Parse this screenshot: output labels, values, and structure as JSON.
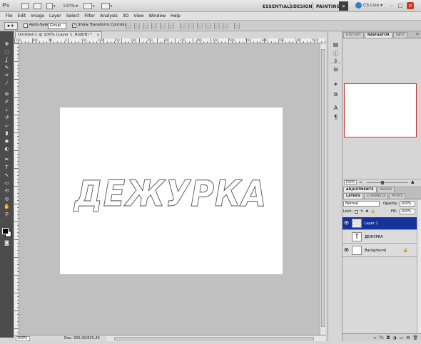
{
  "title_bar": {
    "logo": "Ps",
    "zoom": "100%",
    "workspaces": [
      "ESSENTIALS",
      "DESIGN",
      "PAINTING"
    ],
    "more": "»",
    "cs_live": "CS Live",
    "min": "–",
    "max": "□",
    "close": "×"
  },
  "menu": [
    "File",
    "Edit",
    "Image",
    "Layer",
    "Select",
    "Filter",
    "Analysis",
    "3D",
    "View",
    "Window",
    "Help"
  ],
  "options_bar": {
    "tool_icon": "▸+",
    "auto_select_label": "Auto-Select:",
    "auto_select_value": "Group",
    "show_transform_label": "Show Transform Controls"
  },
  "document": {
    "tab_title": "Untitled-1 @ 100% (Layer 1, RGB/8) *",
    "close": "×",
    "canvas_text": "ДЕЖУРКА",
    "ruler_numbers": [
      "150",
      "100",
      "50",
      "0",
      "50",
      "100",
      "150",
      "200",
      "250",
      "300",
      "350",
      "400",
      "450",
      "500",
      "550",
      "600",
      "650",
      "700",
      "750"
    ]
  },
  "status": {
    "zoom": "100%",
    "doc": "Doc: 900,0K/835,4K"
  },
  "panels": {
    "top_tabs": [
      "HISTORY",
      "NAVIGATOR",
      "INFO"
    ],
    "navigator_zoom": "100%",
    "mid_tabs": [
      "ADJUSTMENTS",
      "MASKS"
    ],
    "layer_tabs": [
      "LAYERS",
      "CHANNELS",
      "PATHS"
    ],
    "blend_mode": "Normal",
    "opacity_label": "Opacity:",
    "opacity_value": "100%",
    "lock_label": "Lock:",
    "fill_label": "Fill:",
    "fill_value": "100%",
    "layers": [
      {
        "name": "Layer 1"
      },
      {
        "name": "ДЕЖУРКА",
        "thumb": "T"
      },
      {
        "name": "Background"
      }
    ],
    "footer_icons": [
      "link-icon",
      "fx-icon",
      "mask-icon",
      "adjustment-icon",
      "folder-icon",
      "new-layer-icon",
      "trash-icon"
    ]
  },
  "colors": {
    "selected_layer": "#16339a",
    "navigator_frame": "#c73838"
  }
}
